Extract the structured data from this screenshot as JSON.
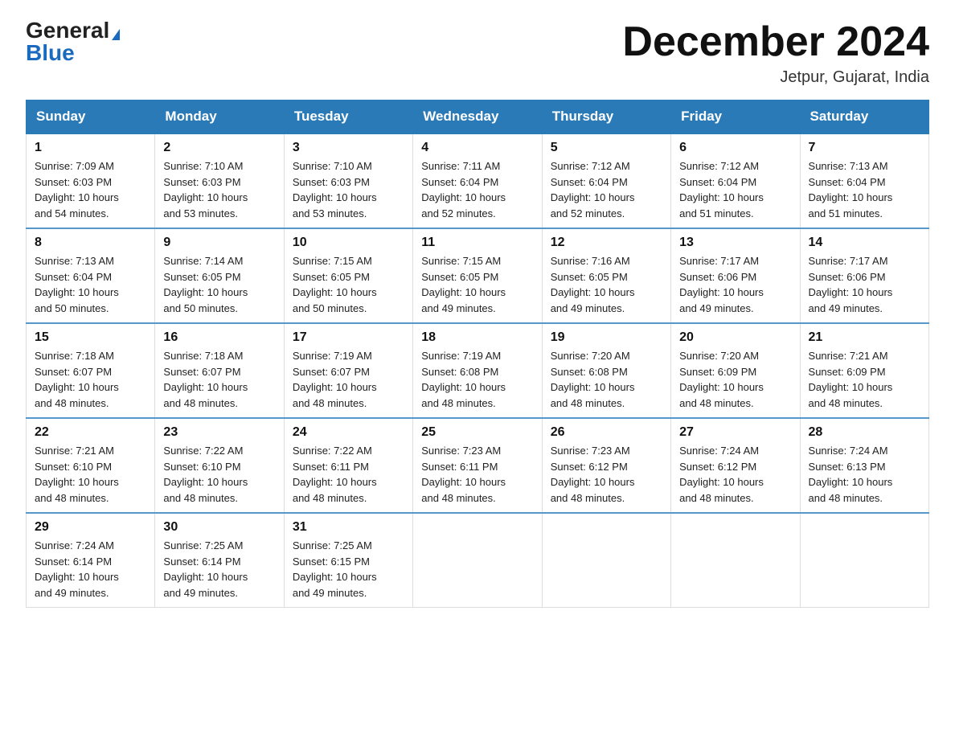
{
  "header": {
    "logo_general": "General",
    "logo_blue": "Blue",
    "month_title": "December 2024",
    "location": "Jetpur, Gujarat, India"
  },
  "days_of_week": [
    "Sunday",
    "Monday",
    "Tuesday",
    "Wednesday",
    "Thursday",
    "Friday",
    "Saturday"
  ],
  "weeks": [
    [
      {
        "day": "1",
        "sunrise": "7:09 AM",
        "sunset": "6:03 PM",
        "daylight": "10 hours and 54 minutes."
      },
      {
        "day": "2",
        "sunrise": "7:10 AM",
        "sunset": "6:03 PM",
        "daylight": "10 hours and 53 minutes."
      },
      {
        "day": "3",
        "sunrise": "7:10 AM",
        "sunset": "6:03 PM",
        "daylight": "10 hours and 53 minutes."
      },
      {
        "day": "4",
        "sunrise": "7:11 AM",
        "sunset": "6:04 PM",
        "daylight": "10 hours and 52 minutes."
      },
      {
        "day": "5",
        "sunrise": "7:12 AM",
        "sunset": "6:04 PM",
        "daylight": "10 hours and 52 minutes."
      },
      {
        "day": "6",
        "sunrise": "7:12 AM",
        "sunset": "6:04 PM",
        "daylight": "10 hours and 51 minutes."
      },
      {
        "day": "7",
        "sunrise": "7:13 AM",
        "sunset": "6:04 PM",
        "daylight": "10 hours and 51 minutes."
      }
    ],
    [
      {
        "day": "8",
        "sunrise": "7:13 AM",
        "sunset": "6:04 PM",
        "daylight": "10 hours and 50 minutes."
      },
      {
        "day": "9",
        "sunrise": "7:14 AM",
        "sunset": "6:05 PM",
        "daylight": "10 hours and 50 minutes."
      },
      {
        "day": "10",
        "sunrise": "7:15 AM",
        "sunset": "6:05 PM",
        "daylight": "10 hours and 50 minutes."
      },
      {
        "day": "11",
        "sunrise": "7:15 AM",
        "sunset": "6:05 PM",
        "daylight": "10 hours and 49 minutes."
      },
      {
        "day": "12",
        "sunrise": "7:16 AM",
        "sunset": "6:05 PM",
        "daylight": "10 hours and 49 minutes."
      },
      {
        "day": "13",
        "sunrise": "7:17 AM",
        "sunset": "6:06 PM",
        "daylight": "10 hours and 49 minutes."
      },
      {
        "day": "14",
        "sunrise": "7:17 AM",
        "sunset": "6:06 PM",
        "daylight": "10 hours and 49 minutes."
      }
    ],
    [
      {
        "day": "15",
        "sunrise": "7:18 AM",
        "sunset": "6:07 PM",
        "daylight": "10 hours and 48 minutes."
      },
      {
        "day": "16",
        "sunrise": "7:18 AM",
        "sunset": "6:07 PM",
        "daylight": "10 hours and 48 minutes."
      },
      {
        "day": "17",
        "sunrise": "7:19 AM",
        "sunset": "6:07 PM",
        "daylight": "10 hours and 48 minutes."
      },
      {
        "day": "18",
        "sunrise": "7:19 AM",
        "sunset": "6:08 PM",
        "daylight": "10 hours and 48 minutes."
      },
      {
        "day": "19",
        "sunrise": "7:20 AM",
        "sunset": "6:08 PM",
        "daylight": "10 hours and 48 minutes."
      },
      {
        "day": "20",
        "sunrise": "7:20 AM",
        "sunset": "6:09 PM",
        "daylight": "10 hours and 48 minutes."
      },
      {
        "day": "21",
        "sunrise": "7:21 AM",
        "sunset": "6:09 PM",
        "daylight": "10 hours and 48 minutes."
      }
    ],
    [
      {
        "day": "22",
        "sunrise": "7:21 AM",
        "sunset": "6:10 PM",
        "daylight": "10 hours and 48 minutes."
      },
      {
        "day": "23",
        "sunrise": "7:22 AM",
        "sunset": "6:10 PM",
        "daylight": "10 hours and 48 minutes."
      },
      {
        "day": "24",
        "sunrise": "7:22 AM",
        "sunset": "6:11 PM",
        "daylight": "10 hours and 48 minutes."
      },
      {
        "day": "25",
        "sunrise": "7:23 AM",
        "sunset": "6:11 PM",
        "daylight": "10 hours and 48 minutes."
      },
      {
        "day": "26",
        "sunrise": "7:23 AM",
        "sunset": "6:12 PM",
        "daylight": "10 hours and 48 minutes."
      },
      {
        "day": "27",
        "sunrise": "7:24 AM",
        "sunset": "6:12 PM",
        "daylight": "10 hours and 48 minutes."
      },
      {
        "day": "28",
        "sunrise": "7:24 AM",
        "sunset": "6:13 PM",
        "daylight": "10 hours and 48 minutes."
      }
    ],
    [
      {
        "day": "29",
        "sunrise": "7:24 AM",
        "sunset": "6:14 PM",
        "daylight": "10 hours and 49 minutes."
      },
      {
        "day": "30",
        "sunrise": "7:25 AM",
        "sunset": "6:14 PM",
        "daylight": "10 hours and 49 minutes."
      },
      {
        "day": "31",
        "sunrise": "7:25 AM",
        "sunset": "6:15 PM",
        "daylight": "10 hours and 49 minutes."
      },
      null,
      null,
      null,
      null
    ]
  ],
  "labels": {
    "sunrise": "Sunrise:",
    "sunset": "Sunset:",
    "daylight": "Daylight:"
  }
}
